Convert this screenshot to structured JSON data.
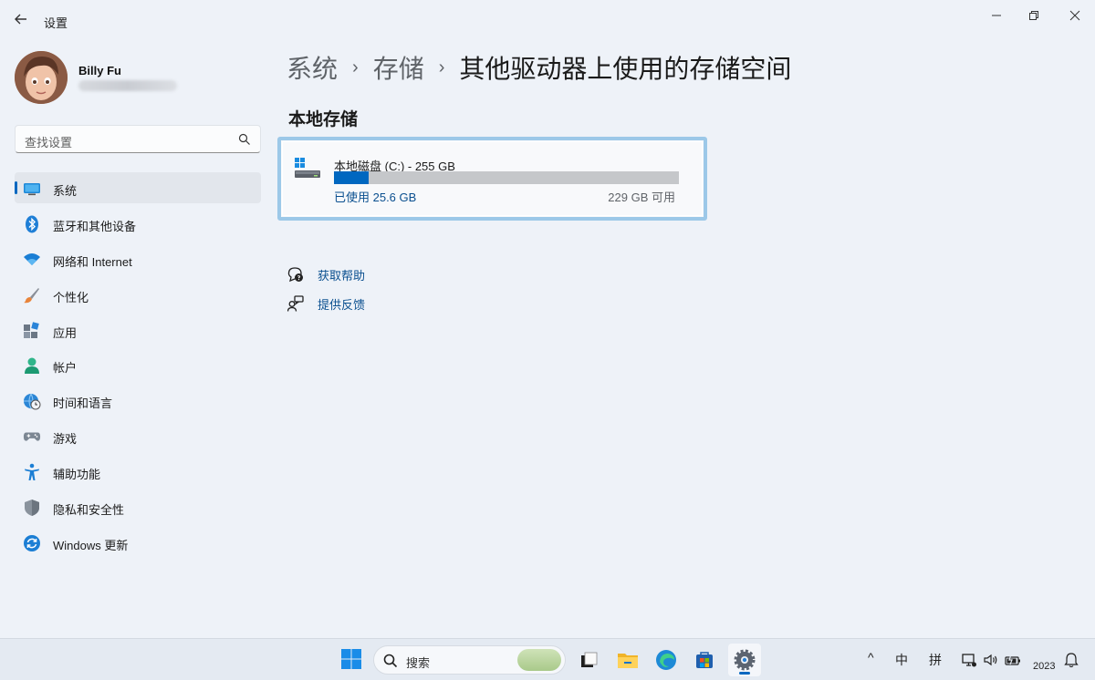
{
  "window": {
    "app_title": "设置",
    "back_icon": "arrow-left-icon",
    "minimize_icon": "minimize-icon",
    "restore_icon": "restore-icon",
    "close_icon": "close-icon"
  },
  "profile": {
    "name": "Billy Fu",
    "email_redacted": true
  },
  "search": {
    "placeholder": "查找设置",
    "icon": "search-icon"
  },
  "sidebar": {
    "items": [
      {
        "label": "系统",
        "icon": "monitor-icon",
        "active": true
      },
      {
        "label": "蓝牙和其他设备",
        "icon": "bluetooth-icon"
      },
      {
        "label": "网络和 Internet",
        "icon": "wifi-icon"
      },
      {
        "label": "个性化",
        "icon": "brush-icon"
      },
      {
        "label": "应用",
        "icon": "apps-icon"
      },
      {
        "label": "帐户",
        "icon": "person-icon"
      },
      {
        "label": "时间和语言",
        "icon": "globe-clock-icon"
      },
      {
        "label": "游戏",
        "icon": "gamepad-icon"
      },
      {
        "label": "辅助功能",
        "icon": "accessibility-icon"
      },
      {
        "label": "隐私和安全性",
        "icon": "shield-icon"
      },
      {
        "label": "Windows 更新",
        "icon": "update-icon"
      }
    ]
  },
  "breadcrumb": {
    "part1": "系统",
    "part2": "存储",
    "current": "其他驱动器上使用的存储空间",
    "separator": "›"
  },
  "main": {
    "section_title": "本地存储",
    "drive": {
      "name": "本地磁盘 (C:) - 255 GB",
      "used_label": "已使用 25.6 GB",
      "free_label": "229 GB 可用",
      "used_fraction": 0.1,
      "icon": "drive-icon",
      "accent_color": "#0067c0"
    },
    "links": [
      {
        "label": "获取帮助",
        "icon": "help-icon"
      },
      {
        "label": "提供反馈",
        "icon": "feedback-icon"
      }
    ]
  },
  "taskbar": {
    "search_text": "搜索",
    "apps": [
      "start-icon",
      "task-view-icon",
      "file-explorer-icon",
      "edge-icon",
      "store-icon",
      "settings-icon"
    ],
    "tray": {
      "chevron": "^",
      "ime_mode": "中",
      "ime_name": "拼",
      "clock": "2023"
    }
  }
}
